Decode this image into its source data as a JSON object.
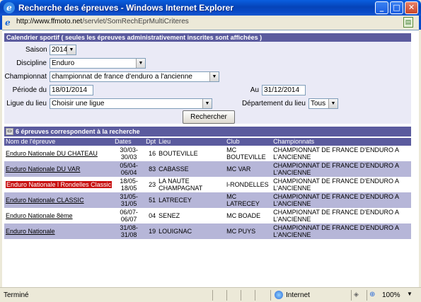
{
  "window": {
    "title": "Recherche des épreuves - Windows Internet Explorer",
    "url_host": "http://www.ffmoto.net",
    "url_path": "/servlet/SomRechEprMultiCriteres",
    "ie_glyph": "e"
  },
  "form": {
    "header": "Calendrier sportif ( seules les épreuves administrativement inscrites sont affichées )",
    "saison_label": "Saison",
    "saison_value": "2014",
    "discipline_label": "Discipline",
    "discipline_value": "Enduro",
    "championnat_label": "Championnat",
    "championnat_value": "championnat de france d'enduro a l'ancienne",
    "periode_label": "Période du",
    "periode_from": "18/01/2014",
    "au_label": "Au",
    "periode_to": "31/12/2014",
    "ligue_label": "Ligue du lieu",
    "ligue_value": "Choisir une ligue",
    "departement_label": "Département du lieu",
    "departement_value": "Tous",
    "search_button": "Rechercher"
  },
  "results": {
    "summary": "6 épreuves correspondent à la recherche",
    "columns": [
      "Nom de l'épreuve",
      "Dates",
      "Dpt",
      "Lieu",
      "Club",
      "Championnats"
    ],
    "rows": [
      {
        "name": "Enduro Nationale DU CHATEAU",
        "dates": "30/03-30/03",
        "dpt": "16",
        "lieu": "BOUTEVILLE",
        "club": "MC BOUTEVILLE",
        "championnats": "CHAMPIONNAT DE FRANCE D'ENDURO A L'ANCIENNE"
      },
      {
        "name": "Enduro Nationale DU VAR",
        "dates": "05/04-06/04",
        "dpt": "83",
        "lieu": "CABASSE",
        "club": "MC VAR",
        "championnats": "CHAMPIONNAT DE FRANCE D'ENDURO A L'ANCIENNE"
      },
      {
        "name": "Enduro Nationale l Rondelles Classic",
        "dates": "18/05-18/05",
        "dpt": "23",
        "lieu": "LA NAUTE CHAMPAGNAT",
        "club": "l-RONDELLES",
        "championnats": "CHAMPIONNAT DE FRANCE D'ENDURO A L'ANCIENNE"
      },
      {
        "name": "Enduro Nationale CLASSIC",
        "dates": "31/05-31/05",
        "dpt": "51",
        "lieu": "LATRECEY",
        "club": "MC LATRECEY",
        "championnats": "CHAMPIONNAT DE FRANCE D'ENDURO A L'ANCIENNE"
      },
      {
        "name": "Enduro Nationale 8ème",
        "dates": "06/07-06/07",
        "dpt": "04",
        "lieu": "SENEZ",
        "club": "MC BOADE",
        "championnats": "CHAMPIONNAT DE FRANCE D'ENDURO A L'ANCIENNE"
      },
      {
        "name": "Enduro Nationale",
        "dates": "31/08-31/08",
        "dpt": "19",
        "lieu": "LOUIGNAC",
        "club": "MC PUYS",
        "championnats": "CHAMPIONNAT DE FRANCE D'ENDURO A L'ANCIENNE"
      }
    ]
  },
  "status": {
    "text": "Terminé",
    "zone": "Internet",
    "zoom": "100%"
  },
  "colors": {
    "header_bg": "#5b5b9e",
    "row_alt": "#b6b6d8",
    "highlight": "#c81010"
  }
}
